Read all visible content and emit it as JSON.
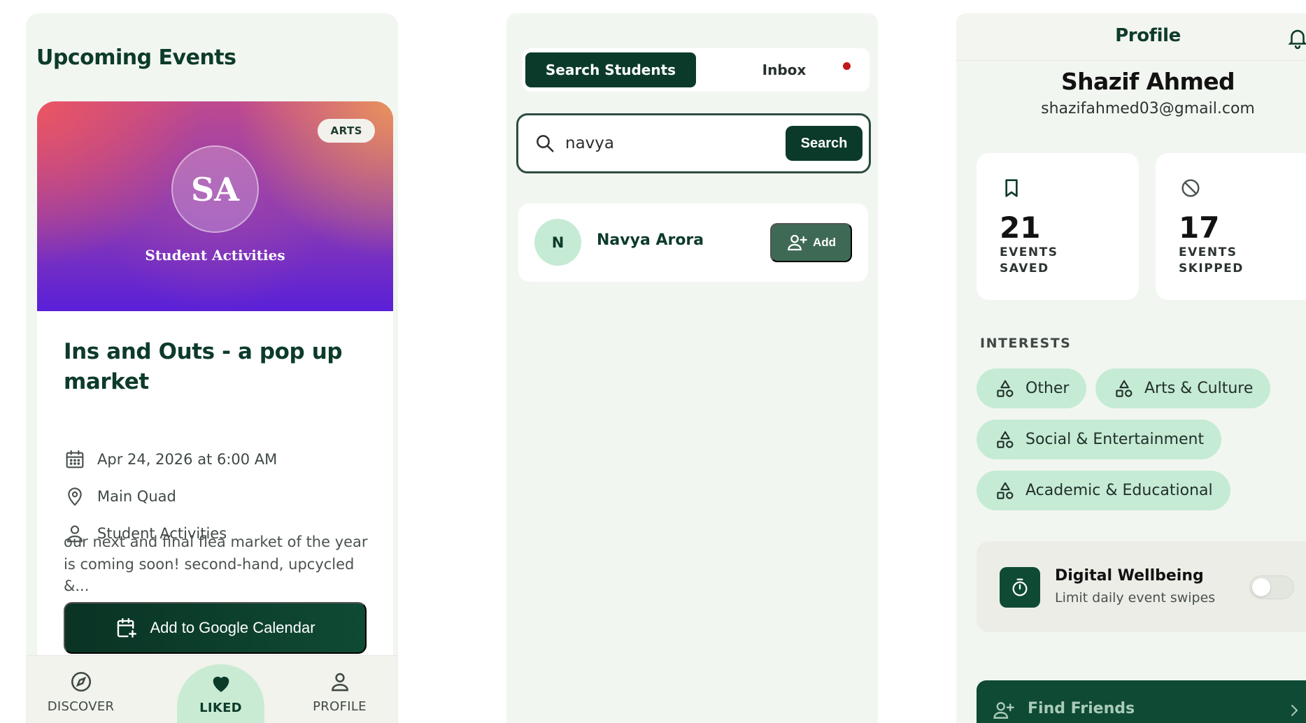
{
  "events": {
    "title": "Upcoming Events",
    "card": {
      "badge": "ARTS",
      "org_initials": "SA",
      "org_name": "Student Activities",
      "name": "Ins and Outs - a pop up market",
      "date": "Apr 24, 2026 at 6:00 AM",
      "location": "Main Quad",
      "host": "Student Activities",
      "description": "our next and final flea market of the year is coming soon! second-hand, upcycled &...",
      "calendar_button": "Add to Google Calendar"
    },
    "nav": [
      {
        "label": "DISCOVER",
        "icon": "compass-icon",
        "active": false
      },
      {
        "label": "LIKED",
        "icon": "heart-icon",
        "active": true
      },
      {
        "label": "PROFILE",
        "icon": "person-icon",
        "active": false
      }
    ]
  },
  "search": {
    "tabs": {
      "active": "Search Students",
      "inbox": "Inbox"
    },
    "inbox_unread_color": "#c21a1a",
    "query": "navya",
    "button": "Search",
    "results": [
      {
        "initial": "N",
        "name": "Navya Arora",
        "action": "Add"
      }
    ]
  },
  "profile": {
    "title": "Profile",
    "name": "Shazif Ahmed",
    "email": "shazifahmed03@gmail.com",
    "stats": [
      {
        "value": "21",
        "label": "EVENTS SAVED",
        "icon": "bookmark-icon"
      },
      {
        "value": "17",
        "label": "EVENTS SKIPPED",
        "icon": "block-icon"
      }
    ],
    "interests_heading": "INTERESTS",
    "interests": [
      "Other",
      "Arts & Culture",
      "Social & Entertainment",
      "Academic & Educational"
    ],
    "wellbeing": {
      "title": "Digital Wellbeing",
      "subtitle": "Limit daily event swipes",
      "enabled": false
    },
    "find_friends": "Find Friends"
  },
  "colors": {
    "brand_dark": "#0c3a2a",
    "brand_mint": "#c5ebd4",
    "panel_bg": "#f2f6f1"
  }
}
